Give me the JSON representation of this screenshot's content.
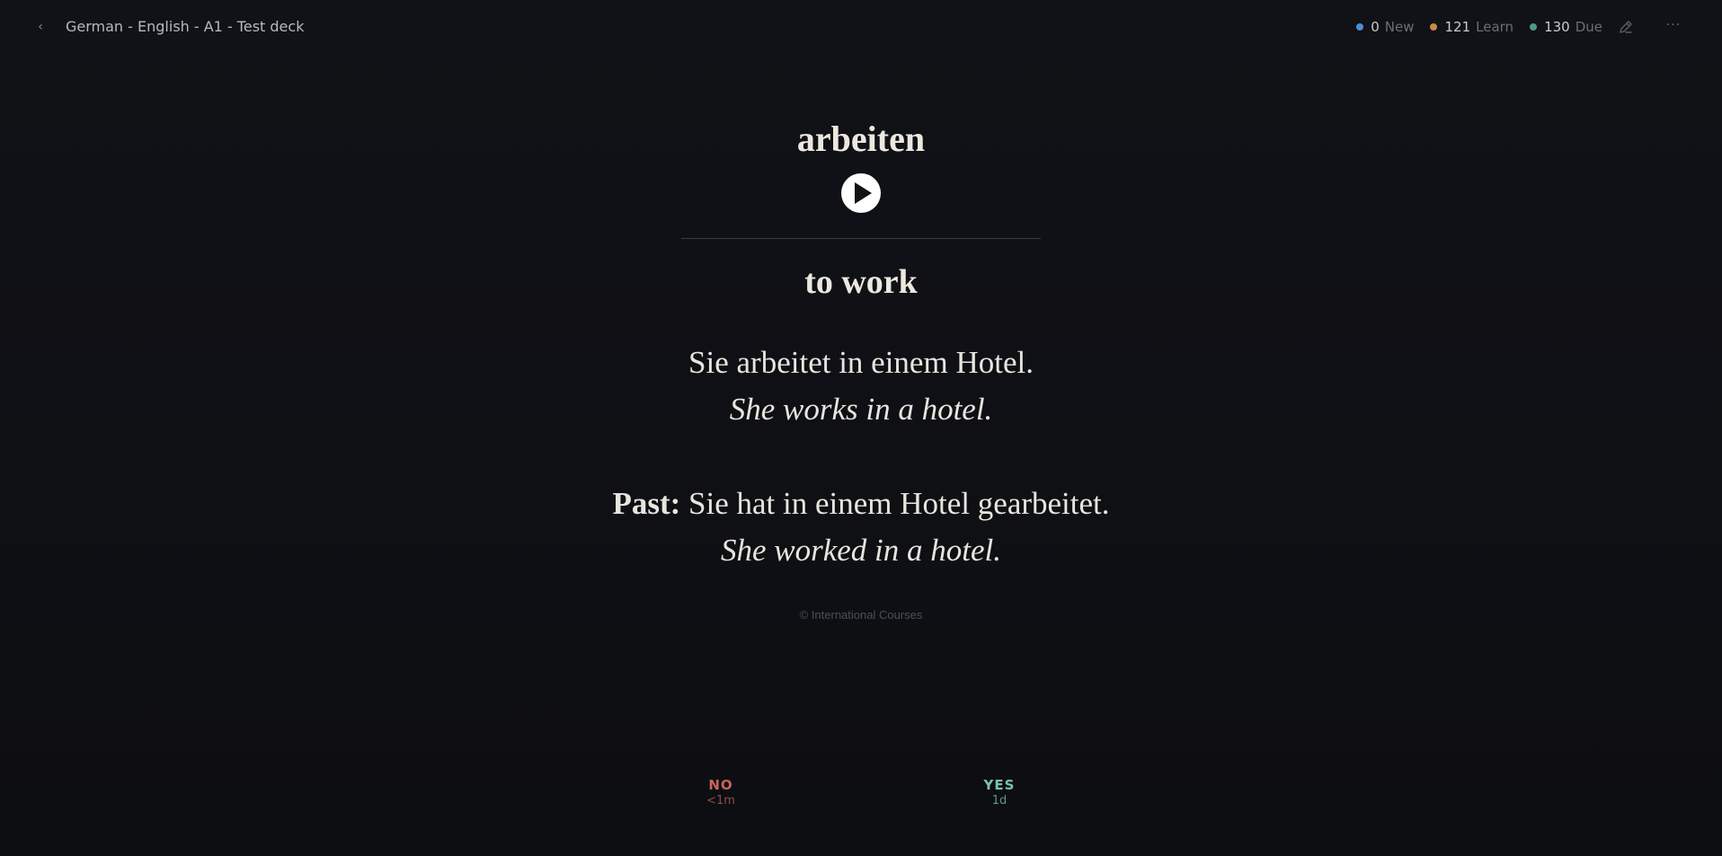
{
  "header": {
    "back_icon": "chevron-left-icon",
    "back_glyph": "‹",
    "deck_title": "German - English - A1 - Test deck",
    "counts": [
      {
        "num": "0",
        "label": "New",
        "color": "#4d8fd1"
      },
      {
        "num": "121",
        "label": "Learn",
        "color": "#c98a46"
      },
      {
        "num": "130",
        "label": "Due",
        "color": "#4e9a7e"
      }
    ],
    "edit_icon": "pencil-icon",
    "more_icon": "ellipsis-icon",
    "more_glyph": "···"
  },
  "card": {
    "word": "arbeiten",
    "play_icon": "play-icon",
    "translation": "to work",
    "example_de": "Sie arbeitet in einem Hotel.",
    "example_en": "She works in a hotel.",
    "past_label": "Past:",
    "past_de": " Sie hat in einem Hotel gearbeitet.",
    "past_en": "She worked in a hotel.",
    "copyright": "© International Courses"
  },
  "answers": {
    "no": {
      "label": "NO",
      "interval": "<1m",
      "color": "#c9645b"
    },
    "yes": {
      "label": "YES",
      "interval": "1d",
      "color": "#7bc4a8"
    }
  }
}
